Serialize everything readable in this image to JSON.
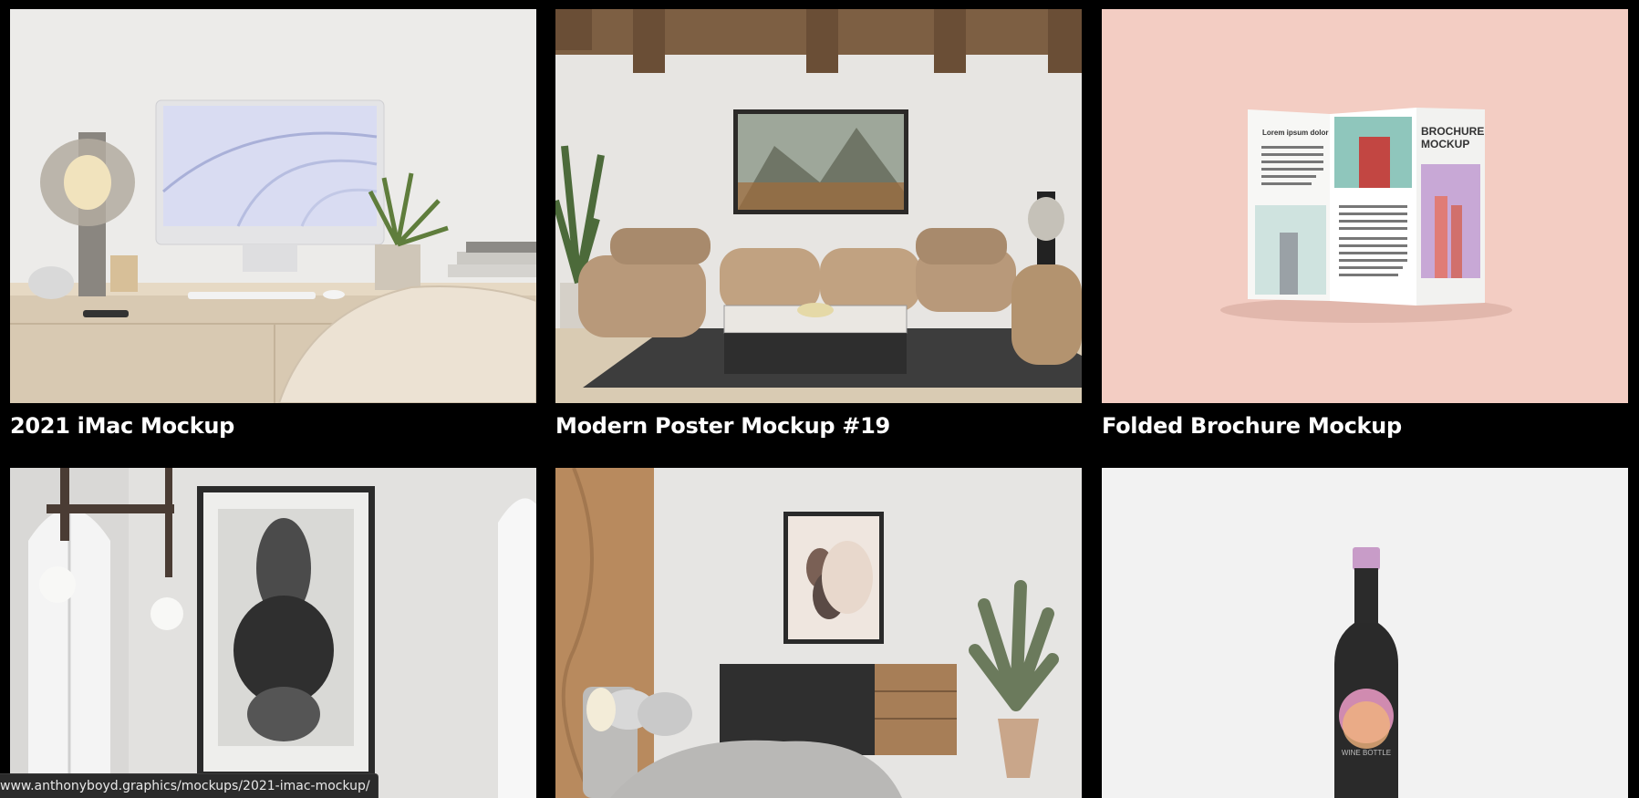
{
  "cards": [
    {
      "title": "2021 iMac Mockup"
    },
    {
      "title": "Modern Poster Mockup #19"
    },
    {
      "title": "Folded Brochure Mockup",
      "brochure_heading_1": "BROCHURE",
      "brochure_heading_2": "MOCKUP",
      "brochure_panel_title": "Lorem ipsum dolor"
    },
    {
      "title": ""
    },
    {
      "title": ""
    },
    {
      "title": "",
      "bottle_label": "WINE BOTTLE"
    }
  ],
  "status_bar": {
    "url": "www.anthonyboyd.graphics/mockups/2021-imac-mockup/"
  }
}
